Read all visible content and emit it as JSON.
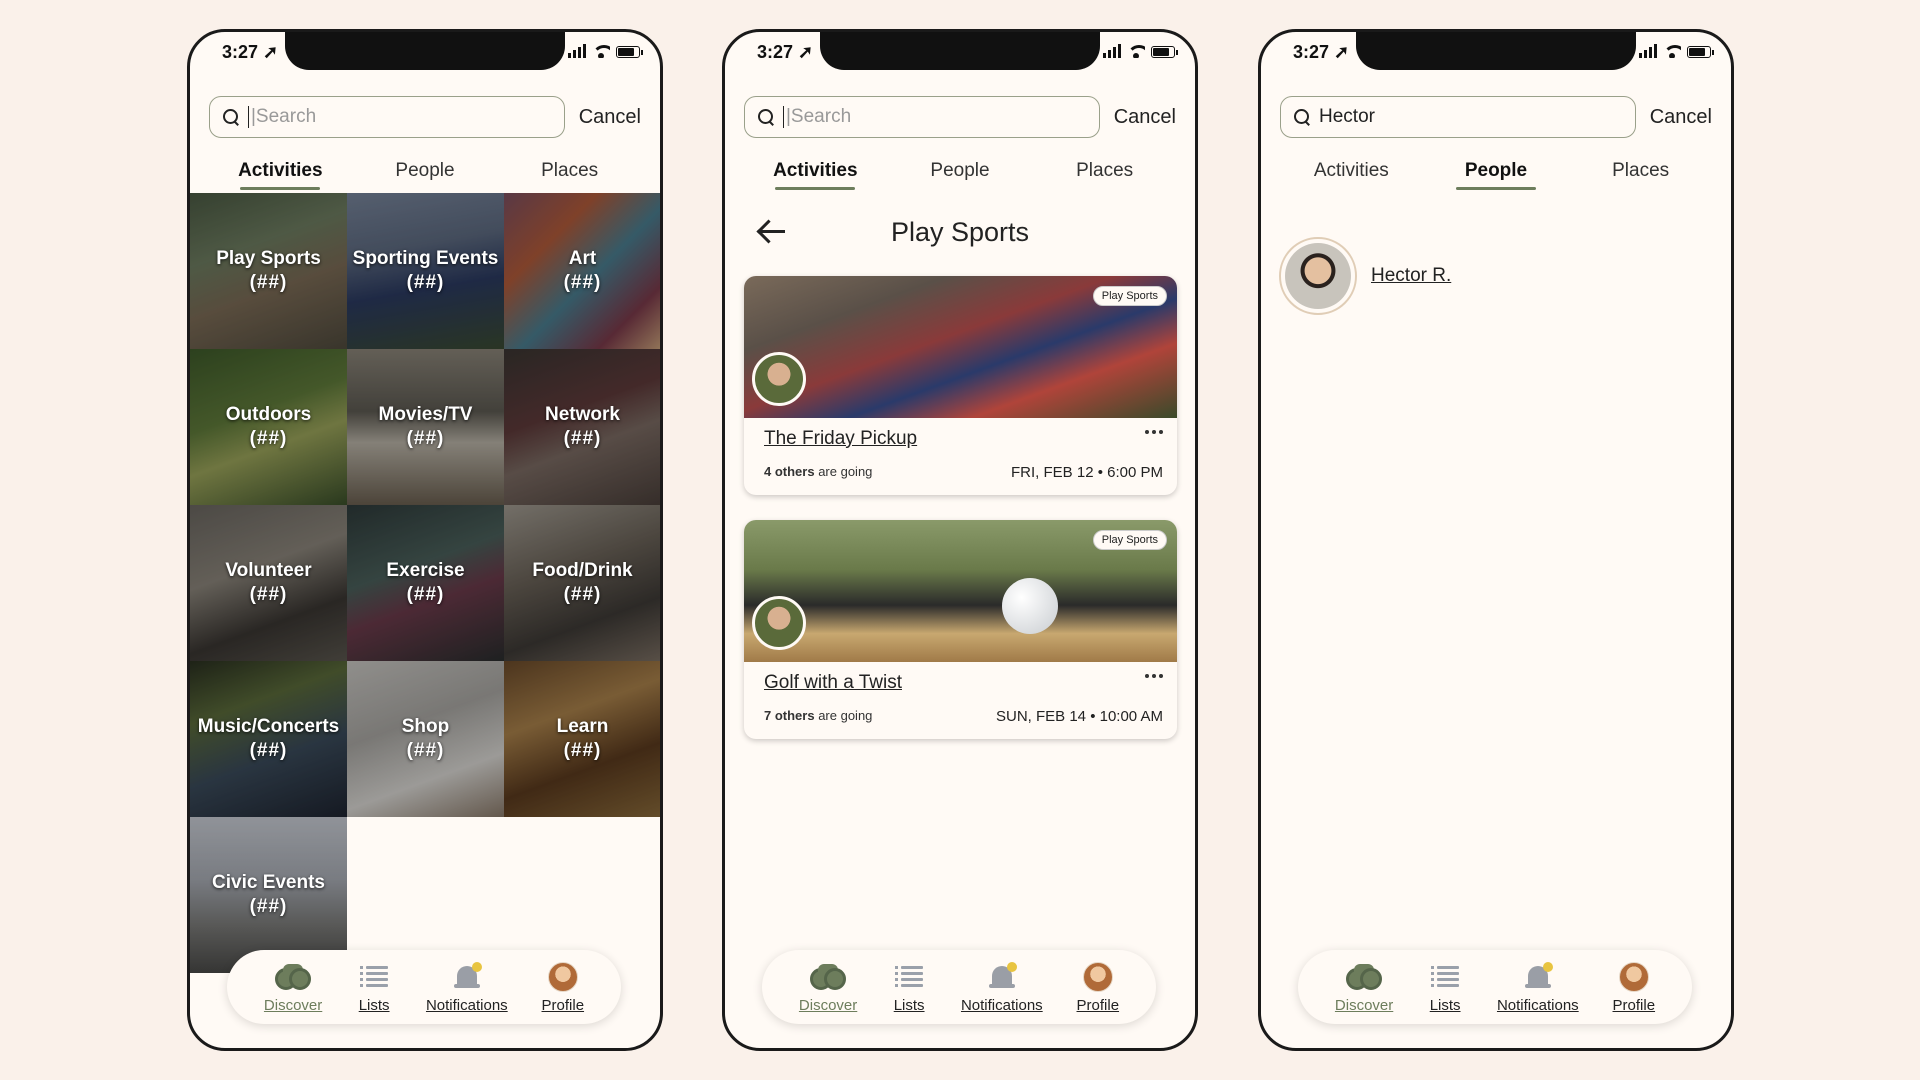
{
  "status": {
    "time": "3:27 ➚"
  },
  "search": {
    "placeholder": "|Search",
    "cancel": "Cancel"
  },
  "tabs": [
    "Activities",
    "People",
    "Places"
  ],
  "activities": [
    {
      "name": "Play Sports",
      "count": "(##)"
    },
    {
      "name": "Sporting Events",
      "count": "(##)"
    },
    {
      "name": "Art",
      "count": "(##)"
    },
    {
      "name": "Outdoors",
      "count": "(##)"
    },
    {
      "name": "Movies/TV",
      "count": "(##)"
    },
    {
      "name": "Network",
      "count": "(##)"
    },
    {
      "name": "Volunteer",
      "count": "(##)"
    },
    {
      "name": "Exercise",
      "count": "(##)"
    },
    {
      "name": "Food/Drink",
      "count": "(##)"
    },
    {
      "name": "Music/Concerts",
      "count": "(##)"
    },
    {
      "name": "Shop",
      "count": "(##)"
    },
    {
      "name": "Learn",
      "count": "(##)"
    },
    {
      "name": "Civic Events",
      "count": "(##)"
    }
  ],
  "category_screen": {
    "title": "Play Sports",
    "events": [
      {
        "tag": "Play Sports",
        "title": "The Friday Pickup",
        "going_count": "4 others",
        "going_suffix": " are going",
        "date": "FRI, FEB 12 • 6:00 PM"
      },
      {
        "tag": "Play Sports",
        "title": "Golf with a Twist",
        "going_count": "7 others",
        "going_suffix": " are going",
        "date": "SUN, FEB 14 • 10:00 AM"
      }
    ]
  },
  "people_screen": {
    "query": "Hector",
    "results": [
      {
        "name": "Hector R."
      }
    ]
  },
  "nav": {
    "items": [
      {
        "label": "Discover",
        "icon": "binoculars-icon",
        "active": true
      },
      {
        "label": "Lists",
        "icon": "list-icon"
      },
      {
        "label": "Notifications",
        "icon": "bell-icon",
        "badge": true
      },
      {
        "label": "Profile",
        "icon": "avatar"
      }
    ]
  },
  "colors": {
    "accent": "#6d7d5c",
    "background": "#faf1ea",
    "screen": "#fffaf5",
    "badge": "#e8c440"
  }
}
